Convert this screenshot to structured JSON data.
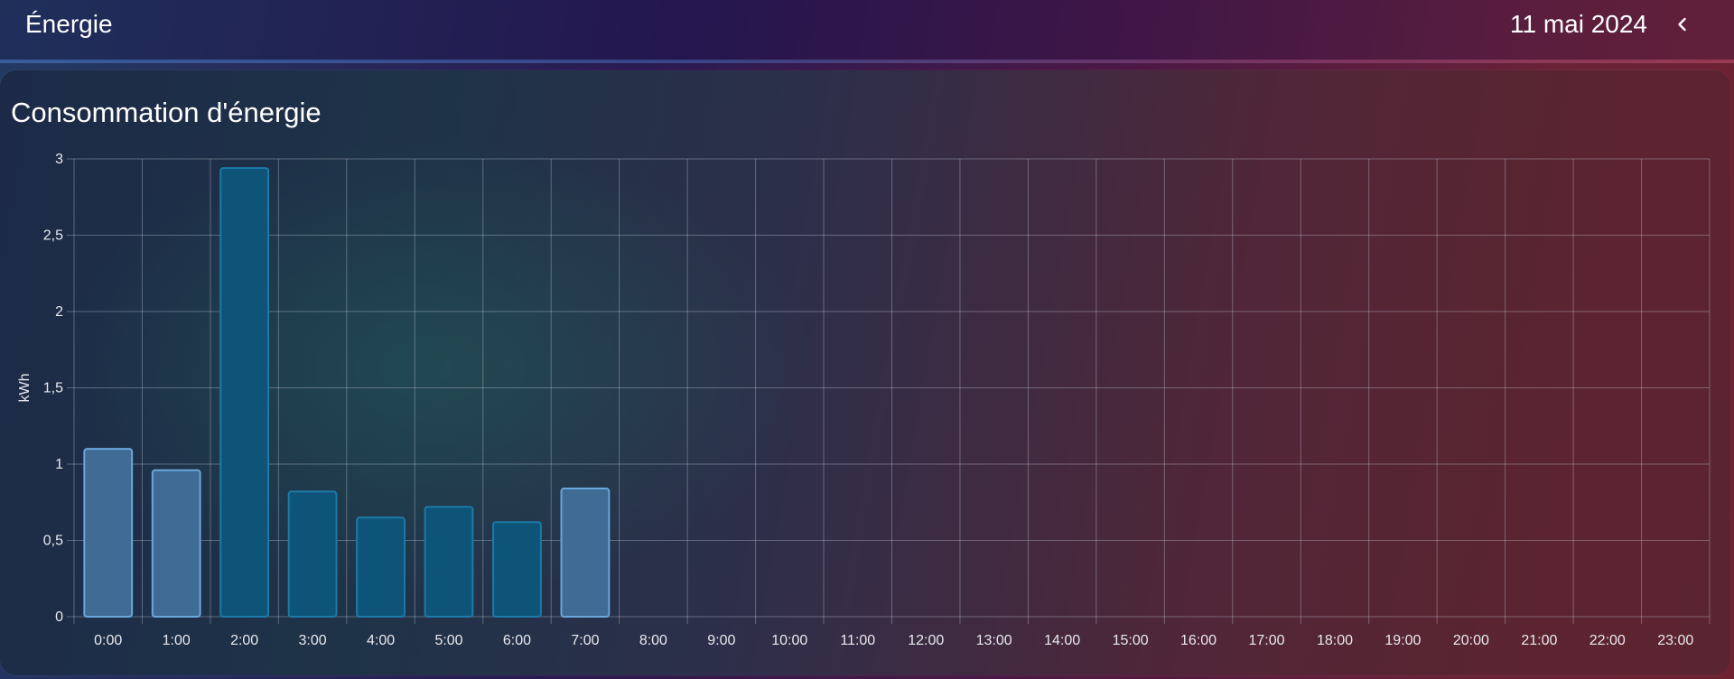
{
  "header": {
    "title": "Énergie",
    "date": "11 mai 2024",
    "back_icon": "chevron-left-icon"
  },
  "card": {
    "title": "Consommation d'énergie"
  },
  "colors": {
    "bar_light_fill": "#3f6b94",
    "bar_light_stroke": "#6aa7db",
    "bar_dark_fill": "#0e5478",
    "bar_dark_stroke": "#1c7aa8",
    "grid": "rgba(210,215,230,0.35)"
  },
  "chart_data": {
    "type": "bar",
    "title": "Consommation d'énergie",
    "xlabel": "",
    "ylabel": "kWh",
    "ylim": [
      0,
      3
    ],
    "y_ticks": [
      "0",
      "0,5",
      "1",
      "1,5",
      "2",
      "2,5",
      "3"
    ],
    "grid": true,
    "categories": [
      "0:00",
      "1:00",
      "2:00",
      "3:00",
      "4:00",
      "5:00",
      "6:00",
      "7:00",
      "8:00",
      "9:00",
      "10:00",
      "11:00",
      "12:00",
      "13:00",
      "14:00",
      "15:00",
      "16:00",
      "17:00",
      "18:00",
      "19:00",
      "20:00",
      "21:00",
      "22:00",
      "23:00"
    ],
    "values": [
      1.1,
      0.96,
      2.94,
      0.82,
      0.65,
      0.72,
      0.62,
      0.84,
      null,
      null,
      null,
      null,
      null,
      null,
      null,
      null,
      null,
      null,
      null,
      null,
      null,
      null,
      null,
      null
    ],
    "bar_styles": [
      "light",
      "light",
      "dark",
      "dark",
      "dark",
      "dark",
      "dark",
      "light"
    ]
  }
}
